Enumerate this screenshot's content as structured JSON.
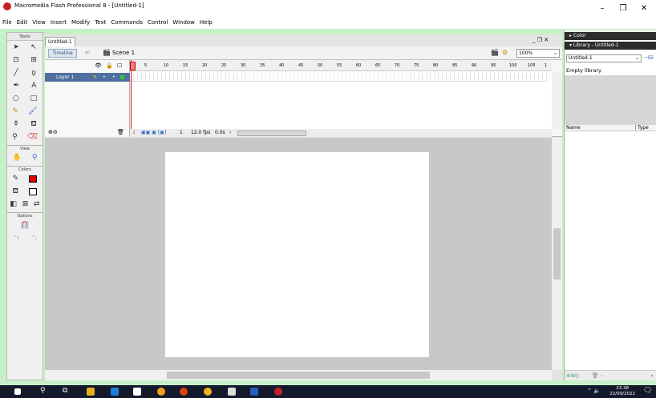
{
  "window": {
    "title": "Macromedia Flash Professional 8 - [Untitled-1]",
    "minimize": "–",
    "maximize": "❐",
    "close": "✕"
  },
  "menu": [
    "File",
    "Edit",
    "View",
    "Insert",
    "Modify",
    "Text",
    "Commands",
    "Control",
    "Window",
    "Help"
  ],
  "tools": {
    "header": "Tools",
    "view_label": "View",
    "colors_label": "Colors",
    "options_label": "Options"
  },
  "document": {
    "tab": "Untitled-1",
    "window_controls": "_ ❐ ✕",
    "timeline_button": "Timeline",
    "scene": "Scene 1",
    "zoom": "100%"
  },
  "timeline": {
    "frame_numbers": [
      "5",
      "10",
      "15",
      "20",
      "25",
      "30",
      "35",
      "40",
      "45",
      "50",
      "55",
      "60",
      "65",
      "70",
      "75",
      "80",
      "85",
      "90",
      "95",
      "100",
      "105",
      "1"
    ],
    "layer": "Layer 1",
    "current_frame": "1",
    "fps": "12.0 fps",
    "time": "0.0s"
  },
  "panels": {
    "color": "Color",
    "library": "Library - Untitled-1",
    "library_select": "Untitled-1",
    "empty_library": "Empty library",
    "col_name": "Name",
    "col_type": "Type"
  },
  "taskbar": {
    "time": "23.38",
    "date": "22/09/2022"
  },
  "colors": {
    "stroke": "#000000",
    "fill": "#e00000",
    "accent": "#c8202a"
  }
}
